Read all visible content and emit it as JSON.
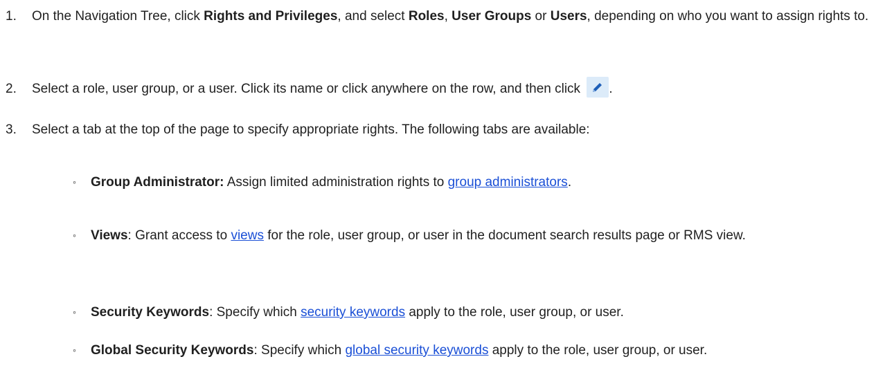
{
  "steps": [
    {
      "number": "1.",
      "parts": {
        "a": "On the Navigation Tree, click ",
        "b1": "Rights and Privileges",
        "c": ", and select ",
        "b2": "Roles",
        "d": ", ",
        "b3": "User Groups",
        "e": " or ",
        "b4": "Users",
        "f": ", depending on who you want to assign rights to."
      }
    },
    {
      "number": "2.",
      "parts": {
        "a": "Select a role, user group, or a user. Click its name or click anywhere on the row, and then click ",
        "icon": "pencil-edit-icon",
        "b": "."
      }
    },
    {
      "number": "3.",
      "parts": {
        "a": "Select a tab at the top of the page to specify appropriate rights. The following tabs are available:"
      }
    }
  ],
  "tabs": [
    {
      "bullet": "◦",
      "name": "Group Administrator:",
      "before_link": " Assign limited administration rights to ",
      "link": "group administrators",
      "after_link": "."
    },
    {
      "bullet": "◦",
      "name": "Views",
      "before_link": ": Grant access to ",
      "link": "views",
      "after_link": " for the role, user group, or user in the document search results page or RMS view."
    },
    {
      "bullet": "◦",
      "name": "Security Keywords",
      "before_link": ": Specify which ",
      "link": "security keywords",
      "after_link": " apply to the role, user group, or user."
    },
    {
      "bullet": "◦",
      "name": "Global Security Keywords",
      "before_link": ": Specify which ",
      "link": "global security keywords",
      "after_link": " apply to the role, user group, or user."
    }
  ],
  "colors": {
    "text": "#1f1f1f",
    "link": "#1a4fd6",
    "edit_button_bg": "#dcebf9",
    "edit_icon": "#1e5fb8"
  }
}
